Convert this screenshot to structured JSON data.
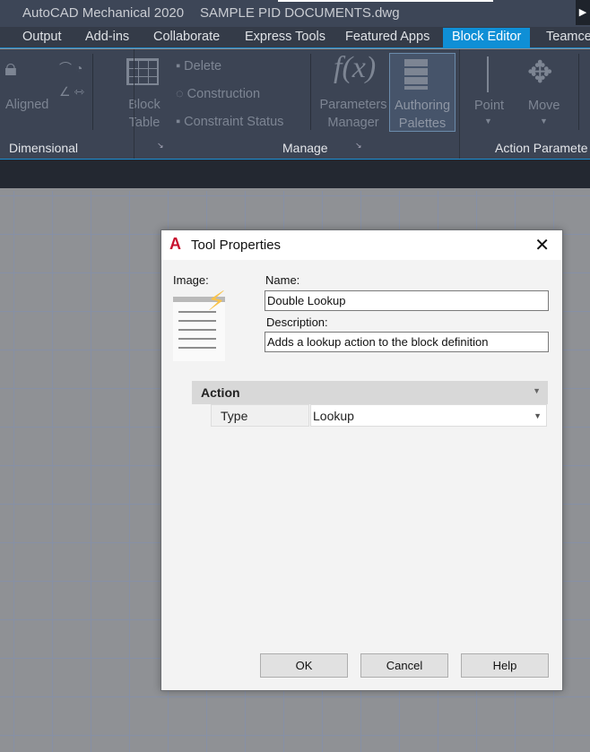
{
  "window": {
    "app_title": "AutoCAD Mechanical 2020",
    "document": "SAMPLE PID DOCUMENTS.dwg"
  },
  "tabs": [
    "Output",
    "Add-ins",
    "Collaborate",
    "Express Tools",
    "Featured Apps",
    "Block Editor",
    "Teamce"
  ],
  "ribbon": {
    "dimensional": {
      "aligned": "Aligned",
      "label": "Dimensional"
    },
    "block_table": [
      "Block",
      "Table"
    ],
    "manage": {
      "delete": "Delete",
      "construction": "Construction",
      "constraint_status": "Constraint Status",
      "parameters_manager": [
        "Parameters",
        "Manager"
      ],
      "authoring_palettes": [
        "Authoring",
        "Palettes"
      ],
      "label": "Manage"
    },
    "action": {
      "point": "Point",
      "move": "Move",
      "label": "Action Paramete"
    }
  },
  "dialog": {
    "title": "Tool Properties",
    "image_label": "Image:",
    "name_label": "Name:",
    "name_value": "Double Lookup",
    "description_label": "Description:",
    "description_value": "Adds a lookup action to the block definition",
    "section": "Action",
    "property": {
      "name": "Type",
      "value": "Lookup"
    },
    "buttons": {
      "ok": "OK",
      "cancel": "Cancel",
      "help": "Help"
    }
  },
  "colors": {
    "accent": "#0f8fd6",
    "autocad_red": "#c8102e"
  }
}
